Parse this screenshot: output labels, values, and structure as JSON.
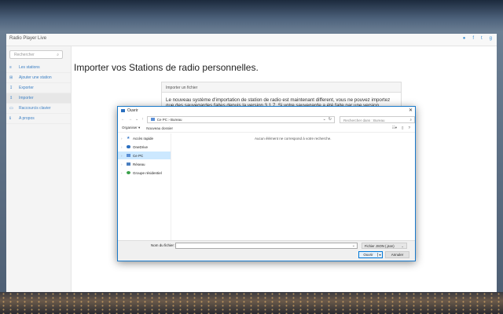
{
  "app": {
    "title": "Radio Player Live",
    "header_icons": [
      "chat-icon",
      "facebook-icon",
      "twitter-icon",
      "gplus-icon"
    ],
    "accent": "#3b7fc4"
  },
  "sidebar": {
    "search_placeholder": "Rechercher",
    "items": [
      {
        "label": "Les stations",
        "icon": "list-icon",
        "active": false
      },
      {
        "label": "Ajouter une station",
        "icon": "plus-square-icon",
        "active": false
      },
      {
        "label": "Exporter",
        "icon": "download-icon",
        "active": false
      },
      {
        "label": "Importer",
        "icon": "upload-icon",
        "active": true
      },
      {
        "label": "Raccourcis clavier",
        "icon": "keyboard-icon",
        "active": false
      },
      {
        "label": "A propos",
        "icon": "info-icon",
        "active": false
      }
    ]
  },
  "main": {
    "title": "Importer vos Stations de radio personnelles.",
    "panel_heading": "Importer un fichier",
    "panel_text": "Le nouveau système d'importation de station de radio est maintenant different, vous ne pouvez importez que des sauvegardes faites depuis la version 3.1.7. Si votre sauvegarde a été faite par une version antérieure, vous"
  },
  "dialog": {
    "title": "Ouvrir",
    "breadcrumb": [
      "Ce PC",
      "Bureau"
    ],
    "search_placeholder": "Rechercher dans : Bureau",
    "toolbar": {
      "organize": "Organiser ▾",
      "new_folder": "Nouveau dossier"
    },
    "nav_items": [
      {
        "label": "Accès rapide",
        "icon": "star-icon",
        "color": "#3a79c9",
        "selected": false
      },
      {
        "label": "OneDrive",
        "icon": "cloud-icon",
        "color": "#2b6fc0",
        "selected": false
      },
      {
        "label": "Ce PC",
        "icon": "pc-icon",
        "color": "#5b8fd6",
        "selected": true
      },
      {
        "label": "Réseau",
        "icon": "network-icon",
        "color": "#4a7fc0",
        "selected": false
      },
      {
        "label": "Groupe résidentiel",
        "icon": "homegroup-icon",
        "color": "#3aa04a",
        "selected": false
      }
    ],
    "empty_message": "Aucun élément ne correspond à votre recherche.",
    "filename_label": "Nom du fichier :",
    "filename_value": "",
    "filetype": "Fichier JSON (.json)",
    "open_button": "Ouvrir",
    "cancel_button": "Annuler"
  }
}
